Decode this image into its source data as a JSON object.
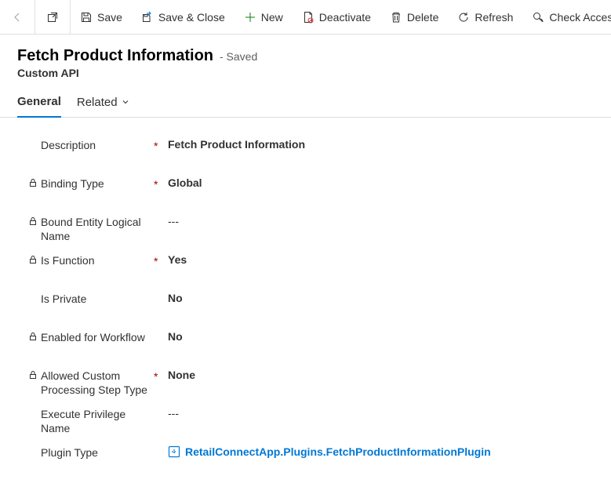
{
  "toolbar": {
    "save": "Save",
    "saveClose": "Save & Close",
    "new": "New",
    "deactivate": "Deactivate",
    "delete": "Delete",
    "refresh": "Refresh",
    "checkAccess": "Check Access"
  },
  "header": {
    "title": "Fetch Product Information",
    "status": "- Saved",
    "subtitle": "Custom API"
  },
  "tabs": {
    "general": "General",
    "related": "Related"
  },
  "fields": {
    "description": {
      "label": "Description",
      "value": "Fetch Product Information"
    },
    "bindingType": {
      "label": "Binding Type",
      "value": "Global"
    },
    "boundEntity": {
      "label": "Bound Entity Logical Name",
      "value": "---"
    },
    "isFunction": {
      "label": "Is Function",
      "value": "Yes"
    },
    "isPrivate": {
      "label": "Is Private",
      "value": "No"
    },
    "enabledWorkflow": {
      "label": "Enabled for Workflow",
      "value": "No"
    },
    "allowedStep": {
      "label": "Allowed Custom Processing Step Type",
      "value": "None"
    },
    "execPriv": {
      "label": "Execute Privilege Name",
      "value": "---"
    },
    "pluginType": {
      "label": "Plugin Type",
      "value": "RetailConnectApp.Plugins.FetchProductInformationPlugin"
    }
  }
}
